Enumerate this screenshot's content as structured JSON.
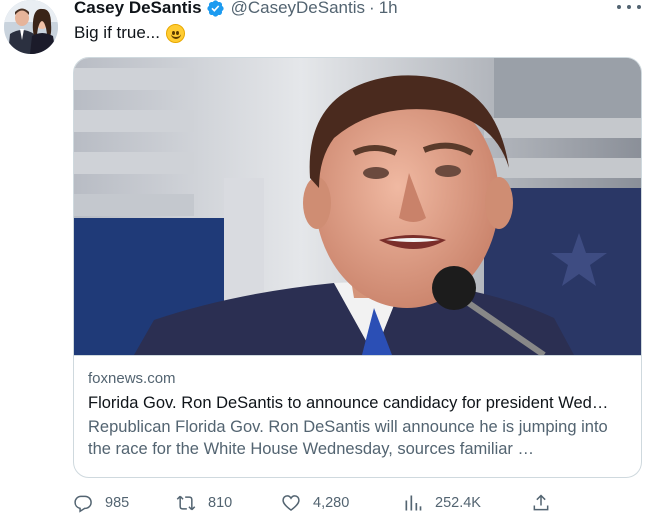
{
  "user": {
    "display_name": "Casey DeSantis",
    "handle": "@CaseyDeSantis",
    "separator": "·",
    "time": "1h",
    "verified": true
  },
  "tweet": {
    "text": "Big if true...",
    "emoji": "slightly-smiling-face"
  },
  "card": {
    "domain": "foxnews.com",
    "title": "Florida Gov. Ron DeSantis to announce candidacy for president Wed…",
    "description": "Republican Florida Gov. Ron DeSantis will announce he is jumping into the race for the White House Wednesday, sources familiar …"
  },
  "actions": {
    "replies": "985",
    "retweets": "810",
    "likes": "4,280",
    "views": "252.4K"
  },
  "icons": {
    "verified": "verified-badge-icon",
    "more": "more-dots-icon",
    "reply": "reply-icon",
    "retweet": "retweet-icon",
    "like": "heart-icon",
    "views": "views-chart-icon",
    "share": "share-icon"
  },
  "colors": {
    "text_primary": "#0f1419",
    "text_secondary": "#536471",
    "verified_blue": "#1d9bf0",
    "border": "#cfd9de"
  }
}
